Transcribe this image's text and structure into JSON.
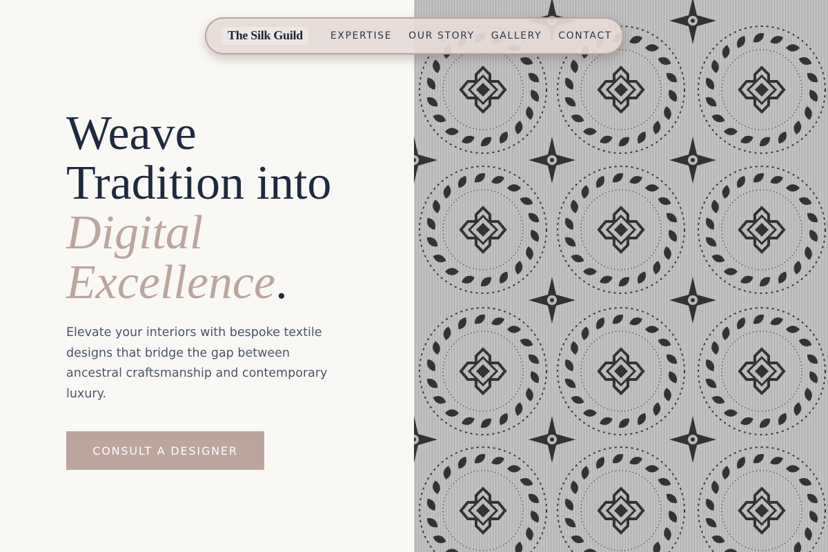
{
  "nav": {
    "brand": "The Silk Guild",
    "items": [
      {
        "label": "EXPERTISE"
      },
      {
        "label": "OUR STORY"
      },
      {
        "label": "GALLERY"
      },
      {
        "label": "CONTACT"
      }
    ]
  },
  "hero": {
    "headline_line1": "Weave",
    "headline_line2": "Tradition into",
    "headline_accent_line1": "Digital",
    "headline_accent_line2": "Excellence",
    "headline_dot": ".",
    "description": "Elevate your interiors with bespoke textile designs that bridge the gap between ancestral craftsmanship and contemporary luxury.",
    "cta_label": "CONSULT A DESIGNER"
  },
  "colors": {
    "background": "#f9f8f5",
    "headline": "#1e2a3d",
    "accent": "#bba59d",
    "nav_background": "#e6dad6",
    "pattern_dark": "#333333",
    "pattern_light": "#b9b9b9"
  },
  "hero_image": {
    "alt": "textile-pattern"
  }
}
